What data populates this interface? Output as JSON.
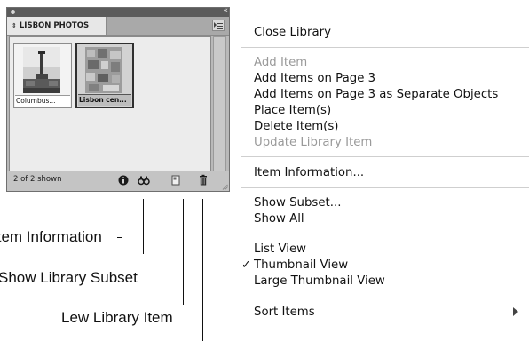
{
  "panel": {
    "tab_label": "LISBON PHOTOS",
    "tab_arrows_icon": "⇕",
    "collapse_icon": "«",
    "items": [
      {
        "label": "Columbus...",
        "selected": false
      },
      {
        "label": "Lisbon cen...",
        "selected": true
      }
    ],
    "status_text": "2 of 2 shown",
    "icons": [
      "info-icon",
      "binoculars-icon",
      "new-library-item-icon",
      "trash-icon"
    ]
  },
  "callouts": {
    "item_information": "Item Information",
    "show_library_subset": "Show Library Subset",
    "new_library_item": "Lew Library Item"
  },
  "menu": {
    "close_library": "Close Library",
    "add_item": "Add Item",
    "add_items_page": "Add Items on Page 3",
    "add_items_page_separate": "Add Items on Page 3 as Separate Objects",
    "place_items": "Place Item(s)",
    "delete_items": "Delete Item(s)",
    "update_library_item": "Update Library Item",
    "item_information": "Item Information...",
    "show_subset": "Show Subset...",
    "show_all": "Show All",
    "list_view": "List View",
    "thumbnail_view": "Thumbnail View",
    "large_thumbnail_view": "Large Thumbnail View",
    "sort_items": "Sort Items",
    "check_mark": "✓"
  },
  "colors": {
    "panel_bg": "#b9b9b9",
    "disabled_text": "#9a9a9a",
    "menu_separator": "#cfcfcf"
  }
}
